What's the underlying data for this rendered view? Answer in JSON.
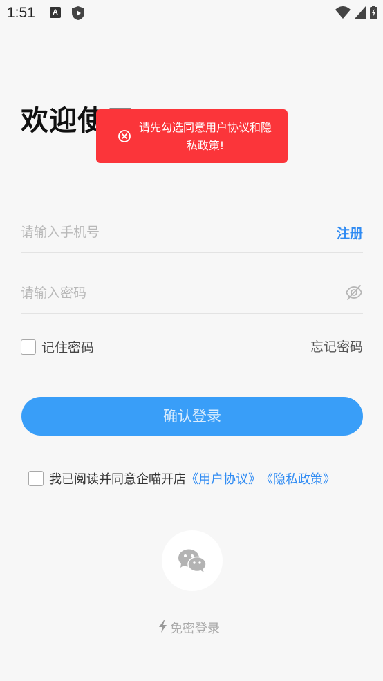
{
  "status_bar": {
    "time": "1:51",
    "notification_icon_letter": "A",
    "icons": [
      "a-notification-icon",
      "shield-play-icon",
      "wifi-icon",
      "signal-icon",
      "battery-icon"
    ]
  },
  "welcome": {
    "title": "欢迎使用"
  },
  "toast": {
    "icon": "error-circle-icon",
    "message": "请先勾选同意用户协议和隐私政策!",
    "color": "#fb353a"
  },
  "form": {
    "phone_placeholder": "请输入手机号",
    "phone_value": "",
    "register_label": "注册",
    "password_placeholder": "请输入密码",
    "password_value": "",
    "password_toggle_icon": "eye-off-icon",
    "remember_label": "记住密码",
    "remember_checked": false,
    "forgot_label": "忘记密码",
    "login_label": "确认登录"
  },
  "agreement": {
    "checked": false,
    "text": "我已阅读并同意企喵开店",
    "user_agreement": "《用户协议》",
    "privacy_policy": "《隐私政策》"
  },
  "quick_login": {
    "wechat_icon": "wechat-icon",
    "label": "免密登录",
    "icon": "lightning-icon"
  },
  "colors": {
    "accent": "#2f8bf3",
    "button": "#399ef8",
    "background": "#f7f7f7",
    "toast": "#fb353a"
  }
}
